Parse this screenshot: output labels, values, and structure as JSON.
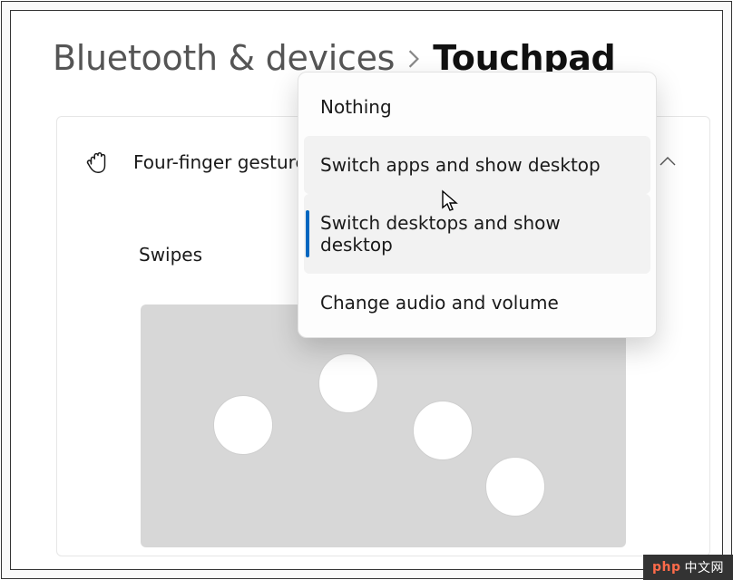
{
  "breadcrumb": {
    "parent": "Bluetooth & devices",
    "current": "Touchpad"
  },
  "card": {
    "title": "Four-finger gestures",
    "section_label": "Swipes"
  },
  "dropdown": {
    "items": [
      {
        "label": "Nothing"
      },
      {
        "label": "Switch apps and show desktop"
      },
      {
        "label": "Switch desktops and show desktop"
      },
      {
        "label": "Change audio and volume"
      }
    ]
  },
  "watermark": {
    "brand": "php",
    "text": "中文网"
  }
}
